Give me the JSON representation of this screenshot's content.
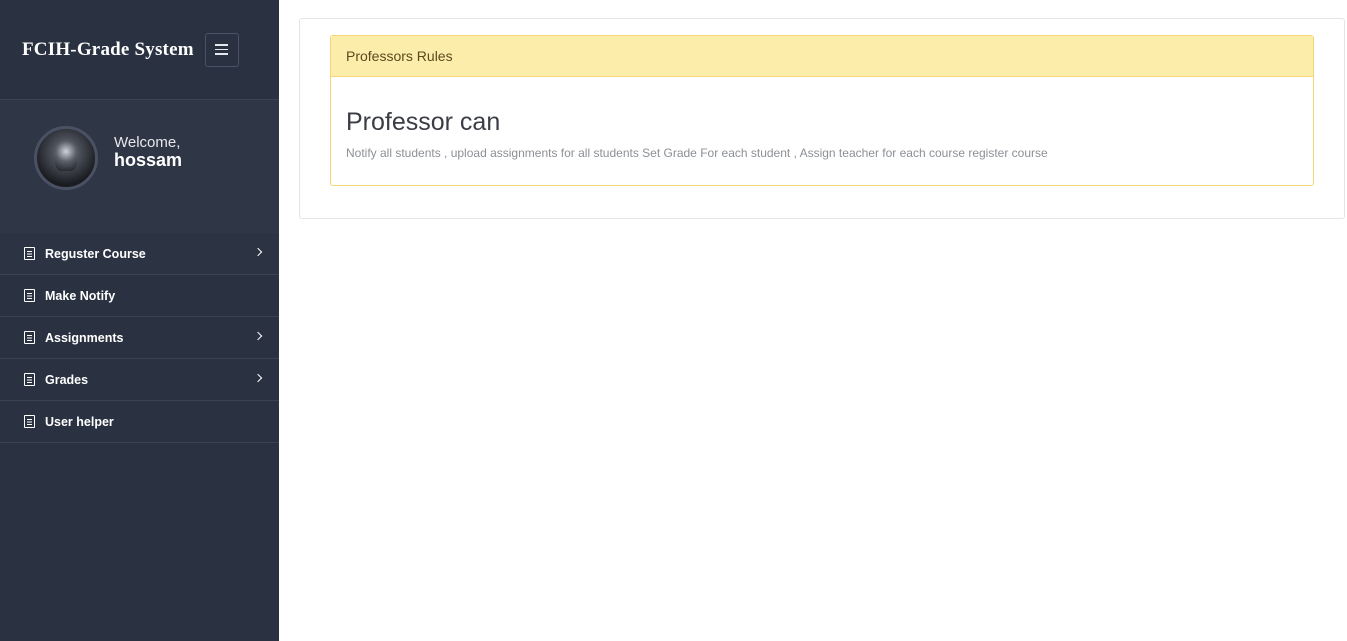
{
  "brand": {
    "title": "FCIH-Grade System"
  },
  "profile": {
    "welcome": "Welcome,",
    "username": "hossam"
  },
  "nav": {
    "items": [
      {
        "label": "Reguster Course",
        "has_submenu": true
      },
      {
        "label": "Make Notify",
        "has_submenu": false
      },
      {
        "label": "Assignments",
        "has_submenu": true
      },
      {
        "label": "Grades",
        "has_submenu": true
      },
      {
        "label": "User helper",
        "has_submenu": false
      }
    ]
  },
  "panel": {
    "heading": "Professors Rules",
    "title": "Professor can",
    "text": "Notify all students , upload assignments for all students Set Grade For each student , Assign teacher for each course register course"
  },
  "colors": {
    "sidebar_bg": "#2a3140",
    "panel_heading_bg": "#fdedaa",
    "panel_border": "#f3d57a"
  }
}
